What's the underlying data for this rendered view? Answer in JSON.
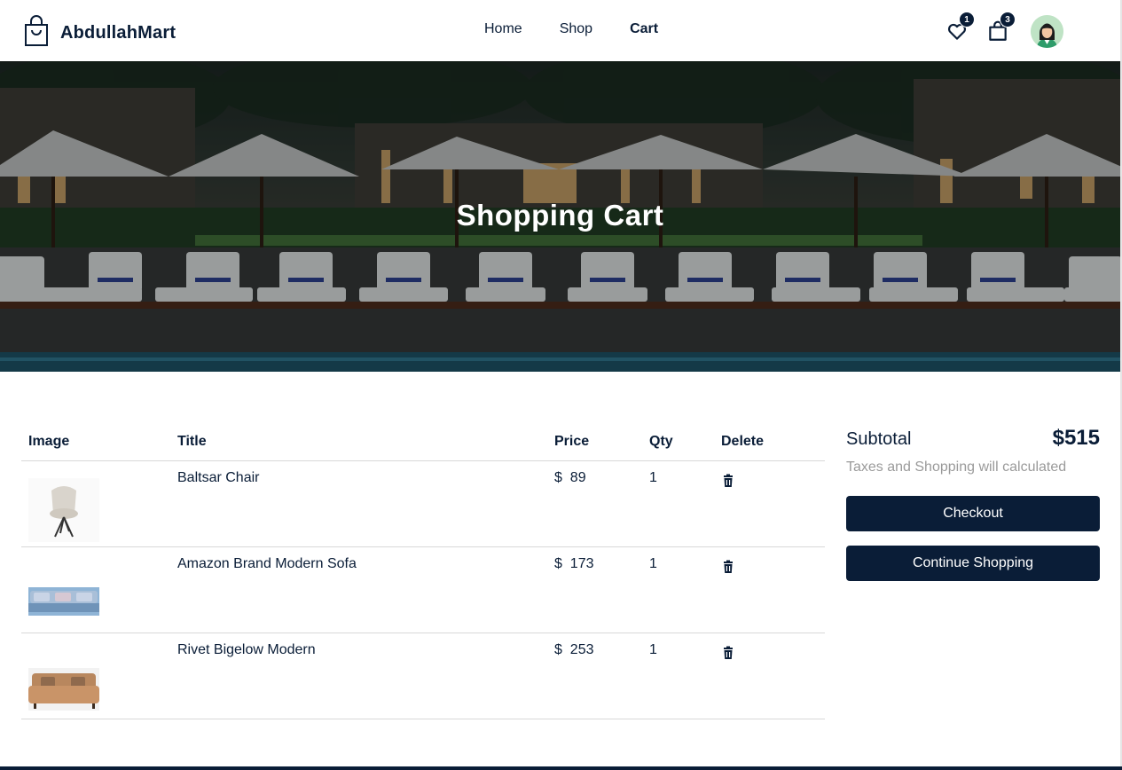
{
  "brand": {
    "name": "AbdullahMart",
    "icon": "shopping-bag-icon"
  },
  "nav": [
    {
      "label": "Home",
      "active": false
    },
    {
      "label": "Shop",
      "active": false
    },
    {
      "label": "Cart",
      "active": true
    }
  ],
  "header_icons": {
    "favorites": {
      "icon": "heart-icon",
      "count": "1"
    },
    "cart": {
      "icon": "bag-icon",
      "count": "3"
    },
    "avatar": {
      "icon": "user-avatar"
    }
  },
  "hero": {
    "title": "Shopping Cart"
  },
  "table": {
    "headers": {
      "image": "Image",
      "title": "Title",
      "price": "Price",
      "qty": "Qty",
      "delete": "Delete"
    },
    "rows": [
      {
        "image": "chair-image",
        "title": "Baltsar Chair",
        "currency": "$",
        "price": "89",
        "qty": "1",
        "delete_icon": "trash-icon"
      },
      {
        "image": "blue-sofa-image",
        "title": "Amazon Brand Modern Sofa",
        "currency": "$",
        "price": "173",
        "qty": "1",
        "delete_icon": "trash-icon"
      },
      {
        "image": "tan-sofa-image",
        "title": "Rivet Bigelow Modern",
        "currency": "$",
        "price": "253",
        "qty": "1",
        "delete_icon": "trash-icon"
      }
    ]
  },
  "summary": {
    "subtotal_label": "Subtotal",
    "subtotal_value": "$515",
    "note": "Taxes and Shopping will calculated",
    "checkout_label": "Checkout",
    "continue_label": "Continue Shopping"
  },
  "colors": {
    "primary": "#0a1d37",
    "muted": "#9a9a9a",
    "divider": "#d8d8d8"
  }
}
